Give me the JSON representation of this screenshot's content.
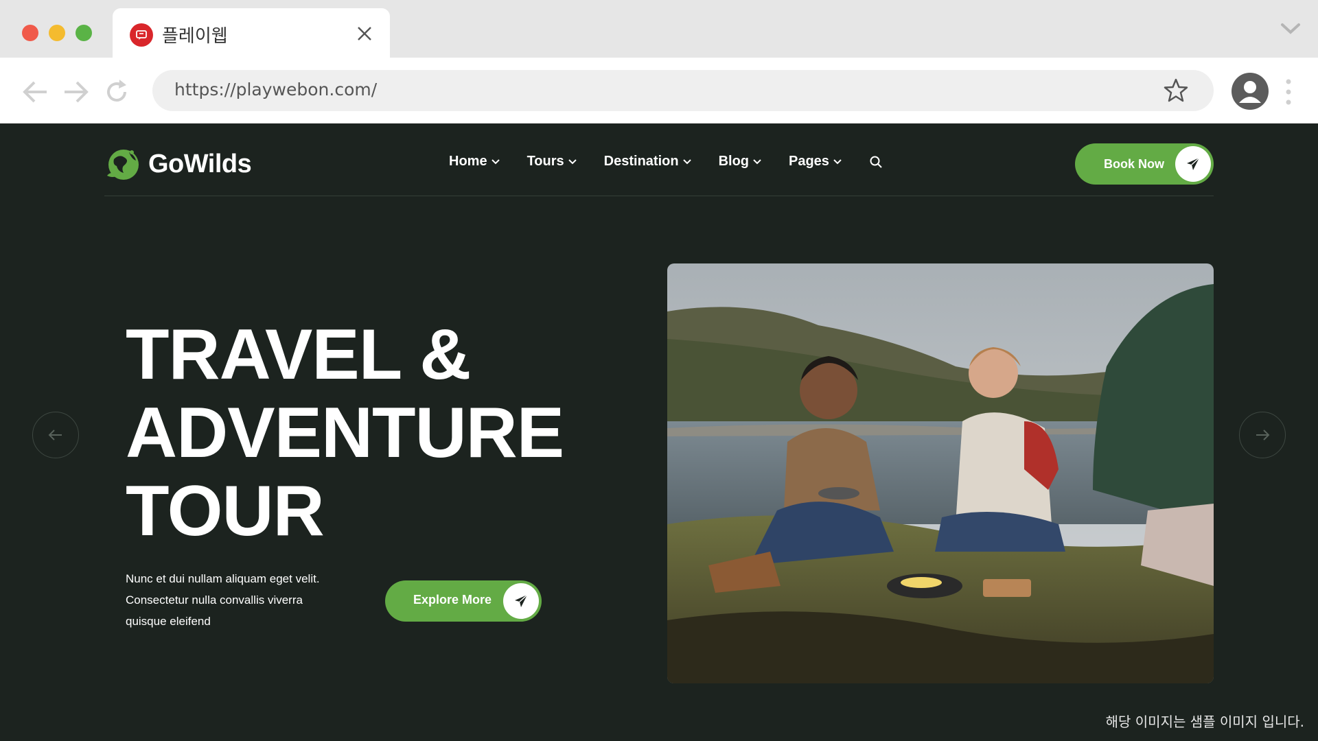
{
  "browser": {
    "tab_title": "플레이웹",
    "url": "https://playwebon.com/"
  },
  "site": {
    "brand": "GoWilds",
    "nav": [
      {
        "label": "Home"
      },
      {
        "label": "Tours"
      },
      {
        "label": "Destination"
      },
      {
        "label": "Blog"
      },
      {
        "label": "Pages"
      }
    ],
    "book_button": "Book Now",
    "hero": {
      "title_lines": [
        "TRAVEL &",
        "ADVENTURE",
        "TOUR"
      ],
      "description": "Nunc et dui nullam aliquam eget velit. Consectetur nulla convallis viverra quisque eleifend",
      "cta": "Explore More"
    },
    "watermark": "해당 이미지는 샘플 이미지 입니다.",
    "colors": {
      "background": "#1c231f",
      "accent": "#63ab45"
    }
  }
}
